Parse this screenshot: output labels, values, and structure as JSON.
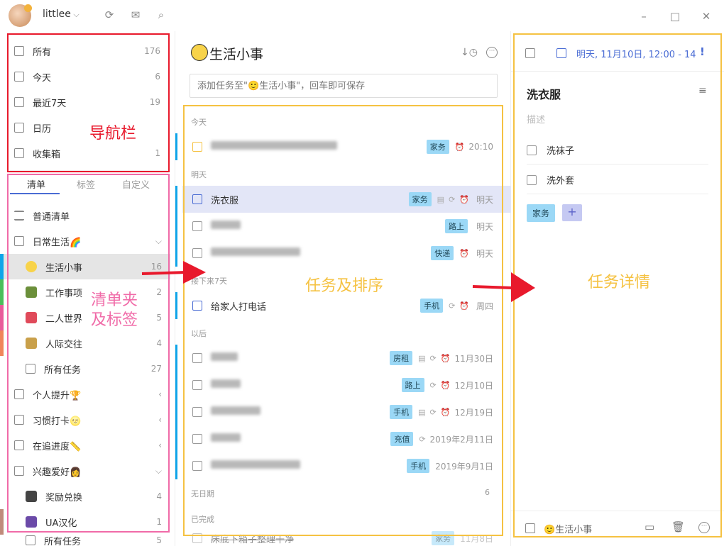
{
  "titlebar": {
    "username": "littlee"
  },
  "nav": {
    "items": [
      {
        "label": "所有",
        "count": "176"
      },
      {
        "label": "今天",
        "count": "6"
      },
      {
        "label": "最近7天",
        "count": "19"
      },
      {
        "label": "日历",
        "count": ""
      },
      {
        "label": "收集箱",
        "count": "1"
      }
    ]
  },
  "tabs": [
    "清单",
    "标签",
    "自定义"
  ],
  "lists": [
    {
      "label": "普通清单",
      "count": ""
    },
    {
      "label": "日常生活🌈",
      "count": ""
    },
    {
      "label": "生活小事",
      "count": "16"
    },
    {
      "label": "工作事项",
      "count": "2"
    },
    {
      "label": "二人世界",
      "count": "5"
    },
    {
      "label": "人际交往",
      "count": "4"
    },
    {
      "label": "所有任务",
      "count": "27"
    },
    {
      "label": "个人提升🏆",
      "count": ""
    },
    {
      "label": "习惯打卡🌝",
      "count": ""
    },
    {
      "label": "在追进度📏",
      "count": ""
    },
    {
      "label": "兴趣爱好👩",
      "count": ""
    },
    {
      "label": "奖励兑换",
      "count": "4"
    },
    {
      "label": "UA汉化",
      "count": "1"
    },
    {
      "label": "所有任务",
      "count": "5"
    }
  ],
  "middle": {
    "title": "生活小事",
    "add_placeholder": "添加任务至\"🙂生活小事\"，回车即可保存",
    "sections": {
      "today": "今天",
      "tomorrow": "明天",
      "next7": "接下来7天",
      "later": "以后",
      "nodate": "无日期",
      "nodate_count": "6",
      "done": "已完成"
    },
    "tasks": [
      {
        "title": "",
        "tag": "家务",
        "date": "20:10"
      },
      {
        "title": "洗衣服",
        "tag": "家务",
        "date": "明天"
      },
      {
        "title": "",
        "tag": "路上",
        "date": "明天"
      },
      {
        "title": "",
        "tag": "快递",
        "date": "明天"
      },
      {
        "title": "给家人打电话",
        "tag": "手机",
        "date": "周四"
      },
      {
        "title": "",
        "tag": "房租",
        "date": "11月30日"
      },
      {
        "title": "",
        "tag": "路上",
        "date": "12月10日"
      },
      {
        "title": "",
        "tag": "手机",
        "date": "12月19日"
      },
      {
        "title": "",
        "tag": "充值",
        "date": "2019年2月11日"
      },
      {
        "title": "",
        "tag": "手机",
        "date": "2019年9月1日"
      },
      {
        "title": "床底下箱子整理干净",
        "tag": "家务",
        "date": "11月8日"
      }
    ]
  },
  "detail": {
    "date_line": "明天, 11月10日, 12:00 - 14",
    "title": "洗衣服",
    "desc_placeholder": "描述",
    "subtasks": [
      "洗袜子",
      "洗外套"
    ],
    "tag": "家务",
    "list_name": "🙂生活小事"
  },
  "annotations": {
    "nav": "导航栏",
    "lists_line1": "清单夹",
    "lists_line2": "及标签",
    "tasks": "任务及排序",
    "detail": "任务详情"
  },
  "colors": {
    "red": "#e8192c",
    "pink": "#f06ba8",
    "yellow": "#f5c242",
    "accent": "#4a6cd4",
    "tag": "#9bd8f6"
  }
}
